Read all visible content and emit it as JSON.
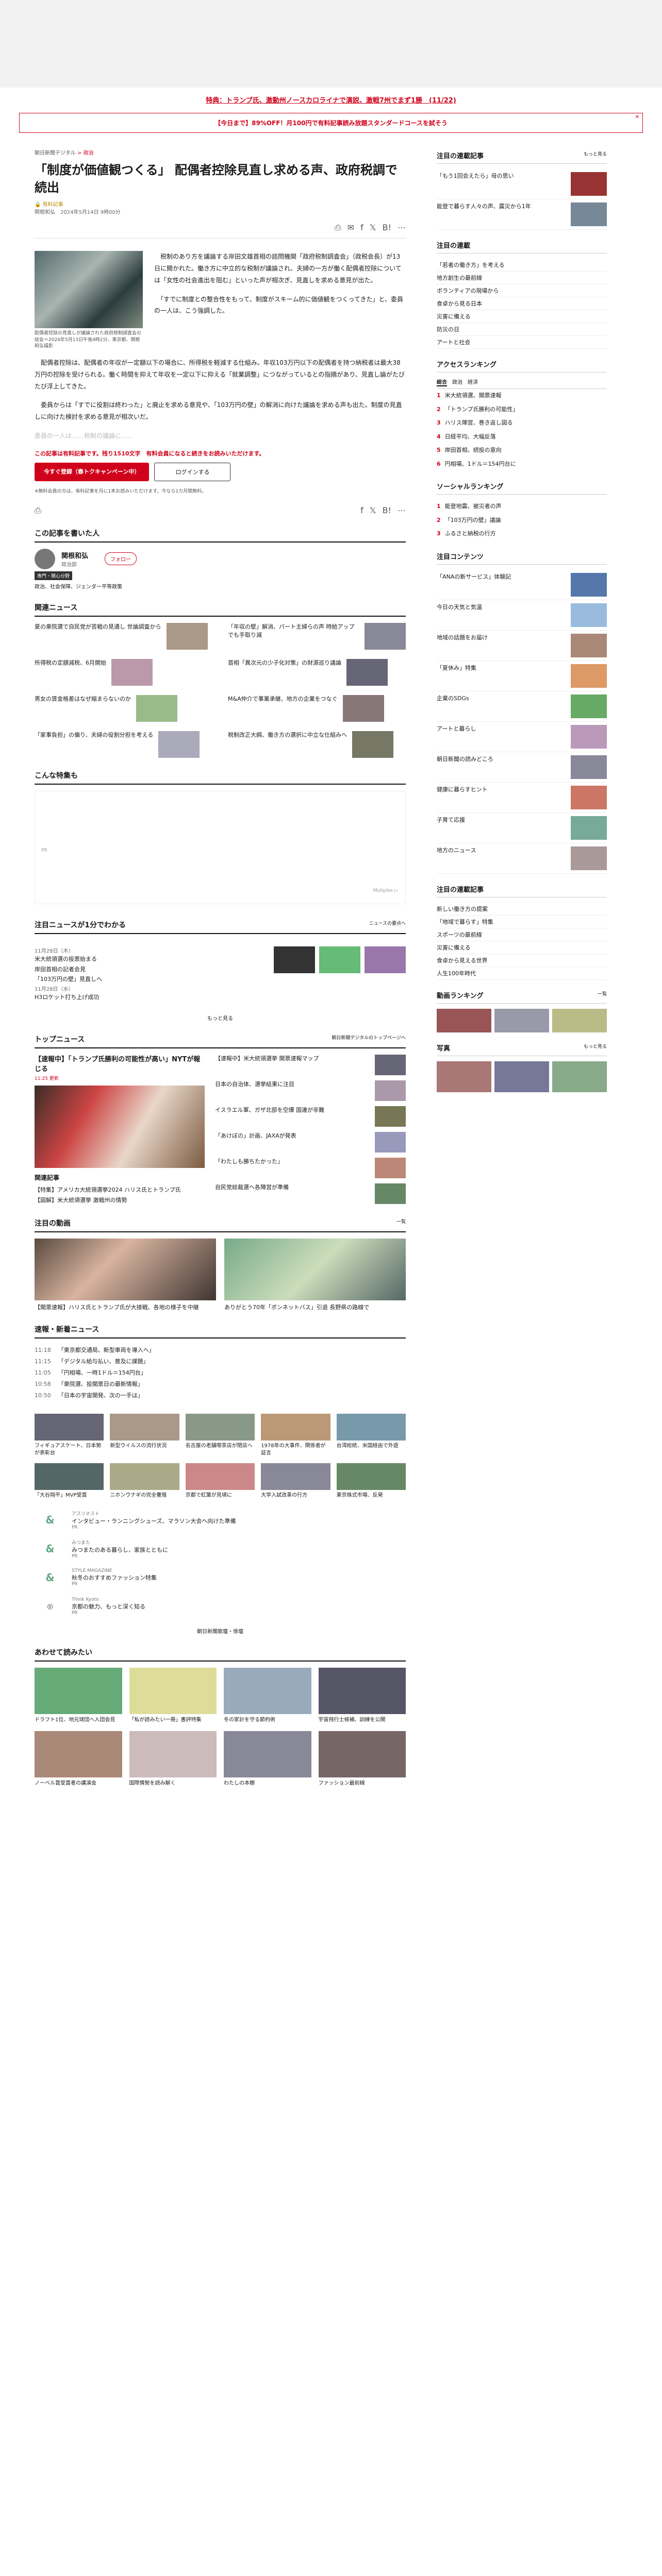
{
  "promo": "特典：トランプ氏、激動州ノースカロライナで演説、激戦7州でまず1勝　(11/22)",
  "banner": "【今日まで】89%OFF！月100円で有料記事読み放題スタンダードコースを試そう",
  "breadcrumb": {
    "site": "朝日新聞デジタル",
    "sep": ">",
    "section": "政治"
  },
  "article": {
    "title": "「制度が価値観つくる」 配偶者控除見直し求める声、政府税調で続出",
    "tag": "有料記事",
    "date": "関根和弘　2024年5月14日 9時00分",
    "share_icons": [
      "print-icon",
      "mail-icon",
      "facebook-icon",
      "x-icon",
      "hatena-icon",
      "more-icon"
    ],
    "caption": "配偶者控除の見直しが議論された政府税制調査会の総会＝2024年5月13日午後4時2分、東京都、関根和弘撮影",
    "p1": "　税制のあり方を議論する岸田文雄首相の諮問機関「政府税制調査会」（政税会長）が13日に開かれた。働き方に中立的な税制が議論され、夫婦の一方が働く配偶者控除については「女性の社会進出を阻む」といった声が相次ぎ、見直しを求める意見が出た。",
    "p2": "　「すでに制度との整合性をもって、制度がスキーム的に価値観をつくってきた」と、委員の一人は、こう強調した。",
    "p3": "　配偶者控除は、配偶者の年収が一定額以下の場合に、所得税を軽減する仕組み。年収103万円以下の配偶者を持つ納税者は最大38万円の控除を受けられる。働く時間を抑えて年収を一定以下に抑える「就業調整」につながっているとの指摘があり、見直し論がたびたび浮上してきた。",
    "p4": "　委員からは「すでに役割は終わった」と廃止を求める意見や、「103万円の壁」の解消に向けた議論を求める声も出た。制度の見直しに向けた検討を求める意見が相次いだ。",
    "fade": "委員の一人は……税制の議論に……",
    "cta_line": "この記事は有料記事です。残り1510文字　有料会員になると続きをお読みいただけます。",
    "cta_red": "今すぐ登録（春トクキャンペーン中）",
    "cta_login": "ログインする",
    "note": "※無料会員の方は、有料記事を月に1本お読みいただけます。今なら1カ月間無料。"
  },
  "author": {
    "heading": "この記事を書いた人",
    "name": "関根和弘",
    "role": "政治部",
    "follow": "フォロー",
    "chip": "専門・関心分野",
    "topics": "政治、社会保障、ジェンダー平等政策"
  },
  "related": {
    "heading": "関連ニュース",
    "items": [
      "夏の衆院選で自民党が苦戦の見通し 世論調査から",
      "「年収の壁」解消、パート主婦らの声 時給アップでも手取り減",
      "所得税の定額減税、6月開始",
      "首相「異次元の少子化対策」の財源巡り議論",
      "男女の賃金格差はなぜ縮まらないのか",
      "M&A仲介で事業承継、地方の企業をつなぐ",
      "「家事負担」の偏り、夫婦の役割分担を考える",
      "税制改正大綱、働き方の選択に中立な仕組みへ"
    ]
  },
  "recommend": {
    "heading": "こんな特集も",
    "ad_label": "PR",
    "vendor": "Mutiplex ▷"
  },
  "timeline": {
    "heading": "注目ニュースが1分でわかる",
    "sub": "ニュースの要点へ",
    "date1": "11月28日（木）",
    "items1": [
      "米大統領選の投票始まる",
      "岸田首相の記者会見",
      "「103万円の壁」見直しへ"
    ],
    "date2": "11月28日（水）",
    "items2": [
      "H3ロケット打ち上げ成功"
    ],
    "more": "もっと見る"
  },
  "topnews": {
    "heading": "トップニュース",
    "sub": "朝日新聞デジタルのトップページへ",
    "lead": "【速報中】「トランプ氏勝利の可能性が高い」NYTが報じる",
    "lead_time": "11:25 更新",
    "items": [
      "【速報中】米大統領選挙 開票速報マップ",
      "日本の自治体、選挙結果に注目",
      "イスラエル軍、ガザ北部を空爆 国連が非難",
      "「あけぼの」計画、JAXAが発表",
      "「わたしも勝ちたかった」",
      "自民党総裁選へ各陣営が準備"
    ],
    "sub2": "関連記事",
    "links": [
      "【特集】アメリカ大統領選挙2024 ハリス氏とトランプ氏",
      "【図解】米大統領選挙 激戦州の情勢"
    ]
  },
  "videos": {
    "heading": "注目の動画",
    "more": "一覧",
    "items": [
      "【開票速報】ハリス氏とトランプ氏が大接戦、各地の様子を中継",
      "ありがとう70年「ボンネットバス」引退 長野県の路線で"
    ]
  },
  "ticker": {
    "heading": "速報・新着ニュース",
    "items": [
      {
        "t": "11:18",
        "s": "「東京都交通局、新型車両を導入へ」"
      },
      {
        "t": "11:15",
        "s": "「デジタル給与払い、普及に課題」"
      },
      {
        "t": "11:05",
        "s": "「円相場、一時1ドル＝154円台」"
      },
      {
        "t": "10:58",
        "s": "「衆院選、投開票日の最新情報」"
      },
      {
        "t": "10:50",
        "s": "「日本の宇宙開発、次の一手は」"
      }
    ]
  },
  "grid": [
    "フィギュアスケート、日本勢が表彰台",
    "新型ウイルスの流行状況",
    "名古屋の老舗喫茶店が閉店へ",
    "1978年の大事件、関係者が証言",
    "台湾総統、米国経由で外遊",
    "「大谷翔平」MVP受賞",
    "ニホンウナギの完全養殖",
    "京都で紅葉が見頃に",
    "大学入試改革の行方",
    "東京株式市場、反発"
  ],
  "ads": [
    {
      "brand": "アスリネスト",
      "title": "インタビュー・ランニングシューズ、マラソン大会へ向けた準備",
      "small": "PR"
    },
    {
      "brand": "みつまた",
      "title": "みつまたのある暮らし、家族とともに",
      "small": "PR"
    },
    {
      "brand": "STYLE MAGAZINE",
      "title": "秋冬のおすすめファッション特集",
      "small": "PR"
    },
    {
      "brand": "Think Kyoto",
      "title": "京都の魅力、もっと深く知る",
      "small": "PR"
    }
  ],
  "more_label": "朝日新聞歌壇・俳壇",
  "later": {
    "heading": "あわせて読みたい",
    "items": [
      "ドラフト1位、地元球団へ入団会見",
      "「私が読みたい一冊」書評特集",
      "冬の家計を守る節約術",
      "宇宙飛行士候補、訓練を公開",
      "ノーベル賞受賞者の講演会",
      "国際情勢を読み解く",
      "わたしの本棚",
      "ファッション最前線"
    ]
  },
  "side": {
    "pickup": {
      "heading": "注目の連載記事",
      "more": "もっと見る",
      "items": [
        "「もう1回会えたら」母の思い",
        "能登で暮らす人々の声、震災から1年"
      ]
    },
    "list1": {
      "heading": "注目の連載",
      "items": [
        "「若者の働き方」を考える",
        "地方創生の最前線",
        "ボランティアの現場から",
        "食卓から見る日本",
        "災害に備える",
        "防災の日",
        "アートと社会"
      ]
    },
    "ranking": {
      "heading": "アクセスランキング",
      "tabs": [
        "総合",
        "政治",
        "経済"
      ],
      "items": [
        "米大統領選、開票速報",
        "「トランプ氏勝利の可能性」",
        "ハリス陣営、巻き返し図る",
        "日経平均、大幅反落",
        "岸田首相、続投の意向",
        "円相場、1ドル＝154円台に"
      ]
    },
    "social": {
      "heading": "ソーシャルランキング",
      "items": [
        "能登地震、被災者の声",
        "「103万円の壁」議論",
        "ふるさと納税の行方"
      ]
    },
    "features": {
      "heading": "注目コンテンツ",
      "items": [
        "「ANAの新サービス」体験記",
        "今日の天気と気温",
        "地域の話題をお届け",
        "「夏休み」特集",
        "企業のSDGs",
        "アートと暮らし",
        "朝日新聞の読みどころ",
        "健康に暮らすヒント",
        "子育て応援",
        "地方のニュース"
      ]
    },
    "ad": {
      "heading": "注目の連載記事",
      "items": [
        "新しい働き方の提案",
        "「地域で暮らす」特集",
        "スポーツの最前線",
        "災害に備える",
        "食卓から見える世界",
        "人生100年時代"
      ]
    },
    "video_rank": {
      "heading": "動画ランキング",
      "more": "一覧"
    },
    "photos": {
      "heading": "写真",
      "more": "もっと見る"
    }
  },
  "accent": "#d0021b"
}
